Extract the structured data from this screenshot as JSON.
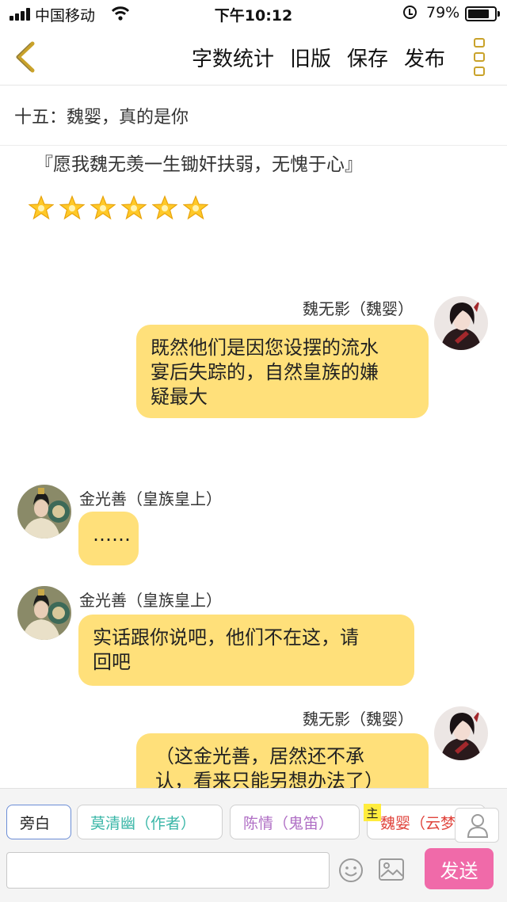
{
  "status_bar": {
    "carrier": "中国移动",
    "time": "下午10:12",
    "battery": "79%"
  },
  "nav": {
    "word_count": "字数统计",
    "old_version": "旧版",
    "save": "保存",
    "publish": "发布"
  },
  "chapter_title": "十五：魏婴，真的是你",
  "chat": {
    "quote": "『愿我魏无羡一生锄奸扶弱，无愧于心』",
    "star_count": 6,
    "messages": [
      {
        "side": "right",
        "speaker": "魏无影（魏婴）",
        "text_lines": [
          "既然他们是因您设摆的流水",
          "宴后失踪的，自然皇族的嫌",
          "疑最大"
        ]
      },
      {
        "side": "left",
        "speaker": "金光善（皇族皇上）",
        "text_lines": [
          "……"
        ]
      },
      {
        "side": "left",
        "speaker": "金光善（皇族皇上）",
        "text_lines": [
          "实话跟你说吧，他们不在这，请",
          "回吧"
        ]
      },
      {
        "side": "right",
        "speaker": "魏无影（魏婴）",
        "text_lines": [
          "（这金光善，居然还不承",
          "认，看来只能另想办法了）"
        ]
      }
    ]
  },
  "toolbar": {
    "roles": [
      {
        "label": "旁白",
        "color": "#222222"
      },
      {
        "label": "莫清幽（作者）",
        "color": "#3bb7a8"
      },
      {
        "label": "陈情（鬼笛）",
        "color": "#b06fc5"
      },
      {
        "label": "魏婴（云梦）",
        "color": "#e0443c"
      }
    ],
    "main_tag": "主",
    "input_value": "",
    "send": "发送"
  }
}
